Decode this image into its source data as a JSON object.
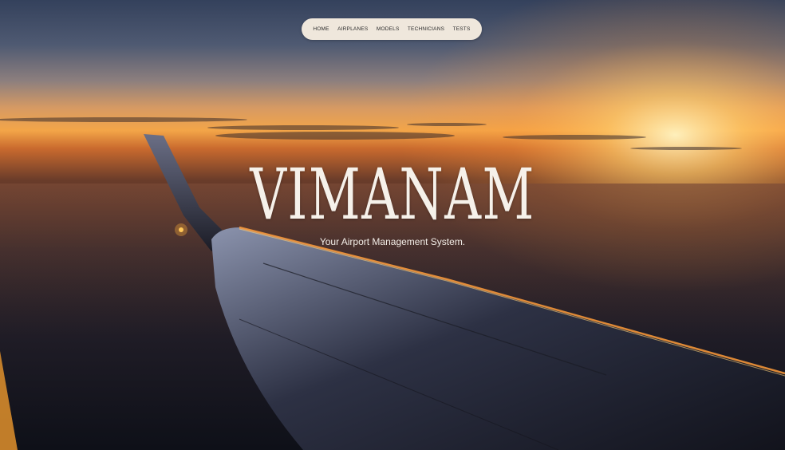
{
  "nav": {
    "items": [
      {
        "label": "HOME"
      },
      {
        "label": "AIRPLANES"
      },
      {
        "label": "MODELS"
      },
      {
        "label": "TECHNICIANS"
      },
      {
        "label": "TESTS"
      }
    ]
  },
  "hero": {
    "title": "VIMANAM",
    "subtitle": "Your Airport Management System."
  },
  "colors": {
    "nav_background": "#efe7dc",
    "nav_text": "#2a2a2a",
    "title_text": "#f6f1ea",
    "sky_top": "#3d4a66",
    "horizon_glow": "#ffb347"
  }
}
